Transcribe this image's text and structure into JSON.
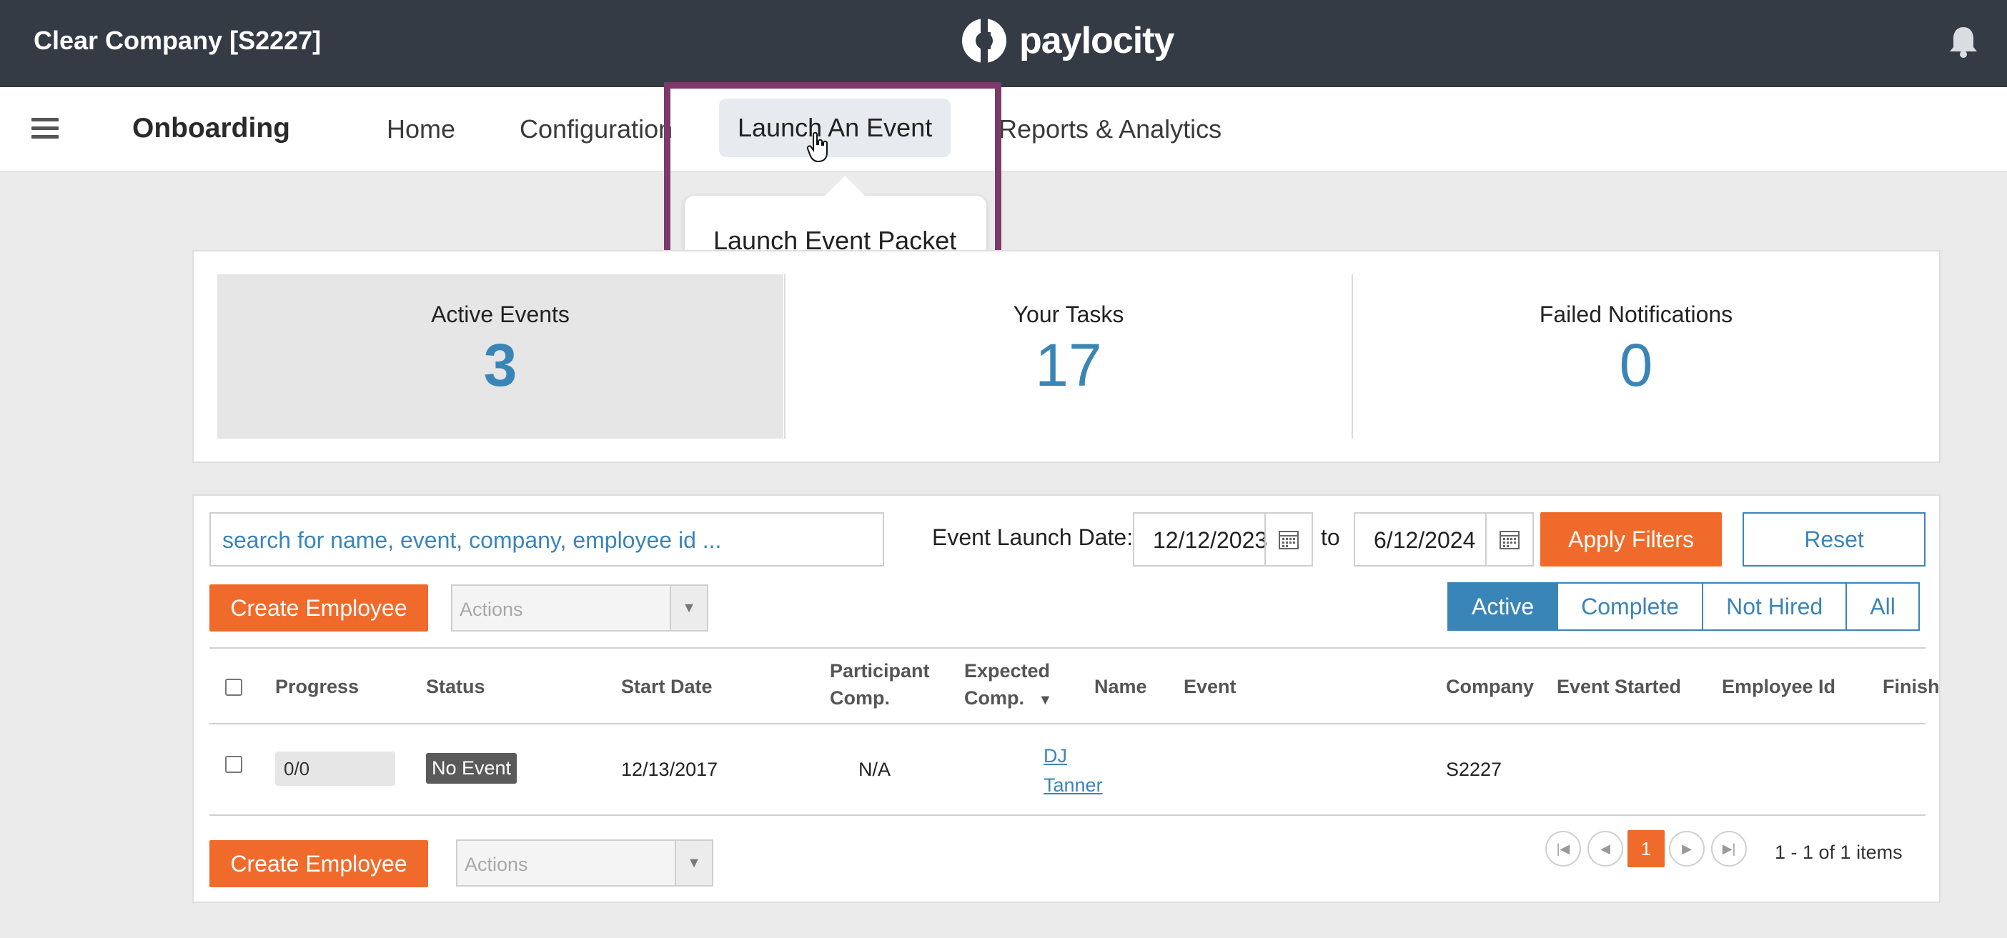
{
  "header": {
    "company": "Clear Company [S2227]",
    "logo_text": "paylocity"
  },
  "nav": {
    "module": "Onboarding",
    "items": [
      "Home",
      "Configuration",
      "Launch An Event",
      "Reports & Analytics"
    ],
    "dropdown_item": "Launch Event Packet"
  },
  "stats": [
    {
      "label": "Active Events",
      "value": "3"
    },
    {
      "label": "Your Tasks",
      "value": "17"
    },
    {
      "label": "Failed Notifications",
      "value": "0"
    }
  ],
  "filters": {
    "search_placeholder": "search for name, event, company, employee id ...",
    "date_label": "Event Launch Date:",
    "date_from": "12/12/2023",
    "to_label": "to",
    "date_to": "6/12/2024",
    "apply_label": "Apply Filters",
    "reset_label": "Reset"
  },
  "toolbar": {
    "create_label": "Create Employee",
    "actions_placeholder": "Actions",
    "tabs": [
      "Active",
      "Complete",
      "Not Hired",
      "All"
    ],
    "selected_tab": "Active"
  },
  "table": {
    "headers": {
      "progress": "Progress",
      "status": "Status",
      "start_date": "Start Date",
      "participant_1": "Participant",
      "participant_2": "Comp.",
      "expected_1": "Expected",
      "expected_2": "Comp.",
      "sort_indicator": "▼",
      "name": "Name",
      "event": "Event",
      "company": "Company",
      "event_started": "Event Started",
      "employee_id": "Employee Id",
      "finish": "Finish"
    },
    "rows": [
      {
        "progress": "0/0",
        "status": "No Event",
        "start_date": "12/13/2017",
        "participant_comp": "N/A",
        "name_first": "DJ",
        "name_last": "Tanner",
        "company": "S2227"
      }
    ]
  },
  "pagination": {
    "current_page": "1",
    "info": "1 - 1 of 1 items"
  },
  "colors": {
    "accent_orange": "#f06b2b",
    "accent_blue": "#3a85b8",
    "header_bg": "#343b45",
    "highlight_border": "#7b3a6a"
  }
}
